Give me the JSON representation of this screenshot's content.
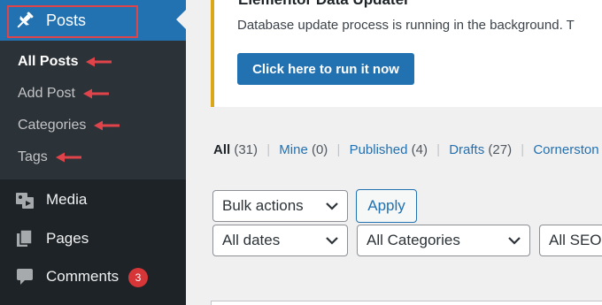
{
  "sidebar": {
    "posts_label": "Posts",
    "submenu": [
      {
        "label": "All Posts"
      },
      {
        "label": "Add Post"
      },
      {
        "label": "Categories"
      },
      {
        "label": "Tags"
      }
    ],
    "items": [
      {
        "label": "Media",
        "icon": "media-icon"
      },
      {
        "label": "Pages",
        "icon": "pages-icon"
      },
      {
        "label": "Comments",
        "icon": "comments-icon",
        "badge": "3"
      }
    ]
  },
  "notice": {
    "title": "Elementor Data Updater",
    "text": "Database update process is running in the background. T",
    "button_label": "Click here to run it now"
  },
  "filters": {
    "all_label": "All",
    "all_count": "(31)",
    "mine_label": "Mine",
    "mine_count": "(0)",
    "published_label": "Published",
    "published_count": "(4)",
    "drafts_label": "Drafts",
    "drafts_count": "(27)",
    "cornerstone_label": "Cornerston",
    "separator": "|"
  },
  "controls": {
    "bulk_actions": "Bulk actions",
    "apply_label": "Apply",
    "all_dates": "All dates",
    "all_categories": "All Categories",
    "all_seo": "All SEO"
  },
  "colors": {
    "sidebar_bg": "#1d2327",
    "submenu_bg": "#2c3338",
    "accent": "#2271b1",
    "annotation_red": "#e0434a",
    "notice_border": "#dba617",
    "badge_red": "#d63638"
  }
}
